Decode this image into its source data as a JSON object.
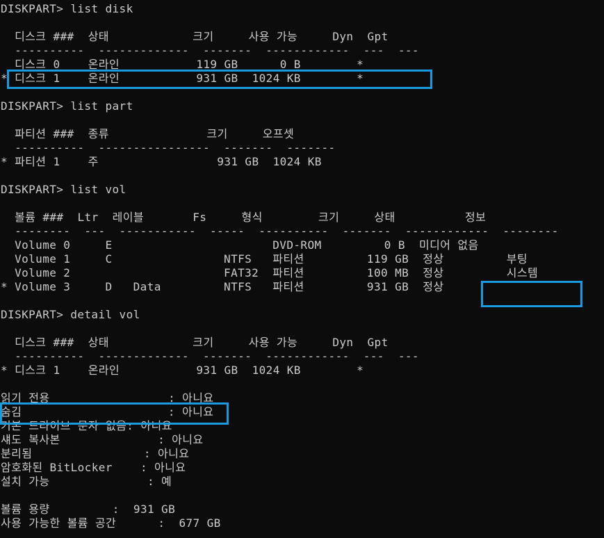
{
  "theme": {
    "background": "#0c0c0c",
    "text": "#cccccc",
    "highlight_border": "#1a9be0"
  },
  "console": {
    "lines": [
      "DISKPART> list disk",
      "",
      "  디스크 ###  상태            크기     사용 가능     Dyn  Gpt",
      "  ----------  -------------  -------  ------------  ---  ---",
      "  디스크 0    온라인           119 GB      0 B        *",
      "* 디스크 1    온라인           931 GB  1024 KB        *",
      "",
      "DISKPART> list part",
      "",
      "  파티션 ###  종류              크기     오프셋",
      "  ----------  ----------------  -------  -------",
      "* 파티션 1    주                 931 GB  1024 KB",
      "",
      "DISKPART> list vol",
      "",
      "  볼륨 ###  Ltr  레이블       Fs     형식        크기     상태          정보",
      "  --------  ---  -----------  -----  ----------  -------  ------------  --------",
      "  Volume 0     E                       DVD-ROM         0 B  미디어 없음",
      "  Volume 1     C                NTFS   파티션         119 GB  정상         부팅",
      "  Volume 2                      FAT32  파티션         100 MB  정상         시스템",
      "* Volume 3     D   Data         NTFS   파티션         931 GB  정상",
      "",
      "DISKPART> detail vol",
      "",
      "  디스크 ###  상태            크기     사용 가능     Dyn  Gpt",
      "  ----------  -------------  -------  ------------  ---  ---",
      "* 디스크 1    온라인           931 GB  1024 KB        *",
      "",
      "읽기 전용                 : 아니요",
      "숨김                     : 아니요",
      "기본 드라이브 문자 없음: 아니요",
      "섀도 복사본              : 아니요",
      "분리됨                : 아니요",
      "암호화된 BitLocker    : 아니요",
      "설치 가능              : 예",
      "",
      "볼륨 용량         :  931 GB",
      "사용 가능한 볼륨 공간      :  677 GB"
    ]
  }
}
